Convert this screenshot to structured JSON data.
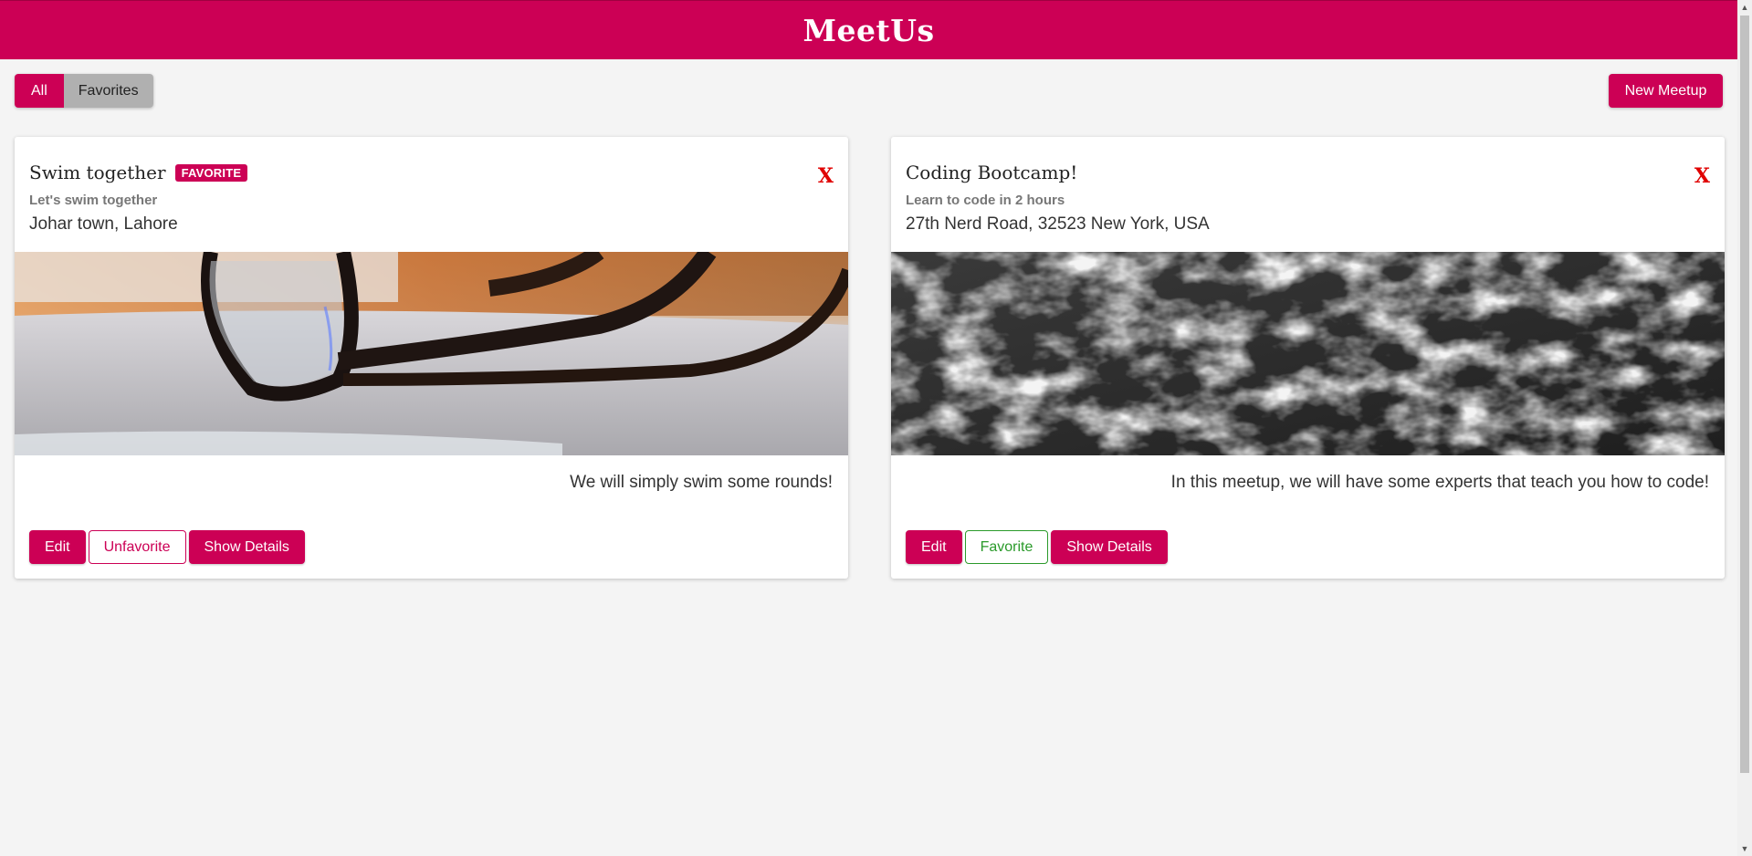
{
  "header": {
    "title": "MeetUs",
    "color": "#cc0055"
  },
  "filters": {
    "all_label": "All",
    "favorites_label": "Favorites",
    "active": "All"
  },
  "toolbar": {
    "new_meetup_label": "New Meetup"
  },
  "meetups": [
    {
      "title": "Swim together",
      "badge": "FAVORITE",
      "subtitle": "Let's swim together",
      "address": "Johar town, Lahore",
      "description": "We will simply swim some rounds!",
      "close_label": "X",
      "image": "eyeglasses-on-laptop-photo",
      "edit_label": "Edit",
      "favorite_toggle_label": "Unfavorite",
      "details_label": "Show Details"
    },
    {
      "title": "Coding Bootcamp!",
      "subtitle": "Learn to code in 2 hours",
      "address": "27th Nerd Road, 32523 New York, USA",
      "description": "In this meetup, we will have some experts that teach you how to code!",
      "close_label": "X",
      "image": "ocean-waves-photo",
      "edit_label": "Edit",
      "favorite_toggle_label": "Favorite",
      "details_label": "Show Details"
    }
  ]
}
